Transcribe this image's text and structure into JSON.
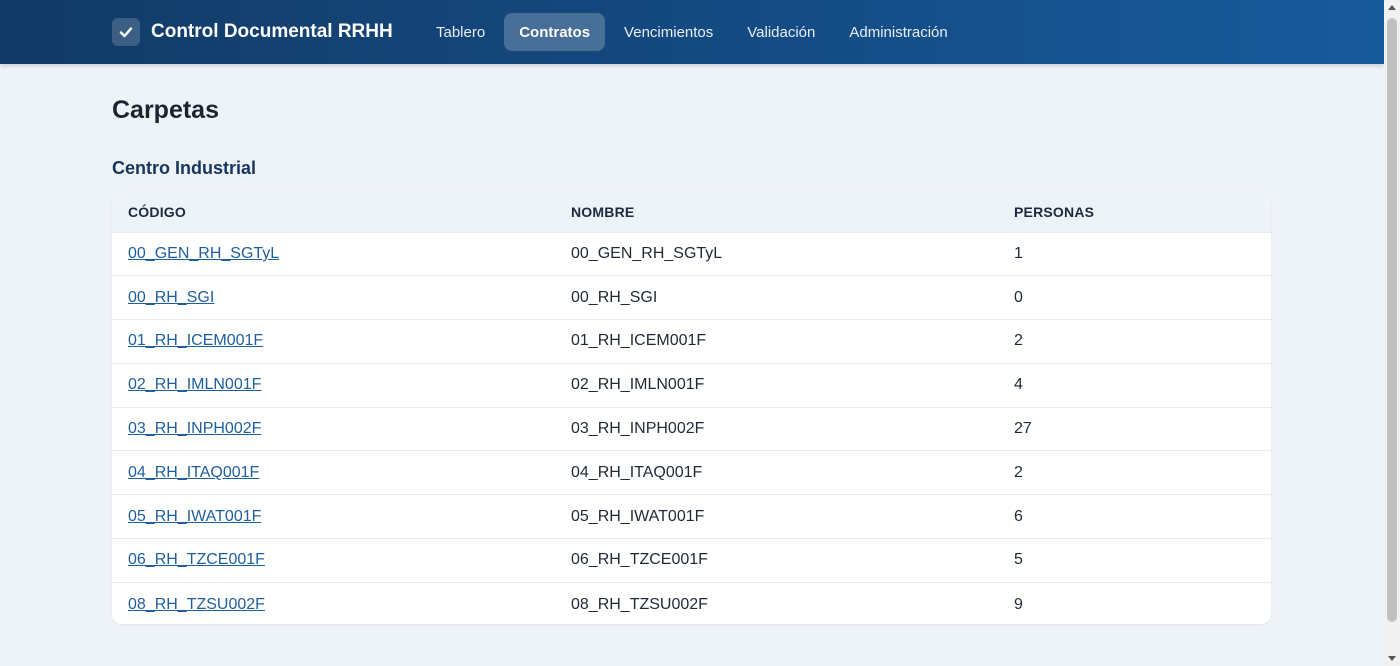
{
  "app": {
    "title": "Control Documental RRHH",
    "nav": [
      {
        "label": "Tablero",
        "active": false
      },
      {
        "label": "Contratos",
        "active": true
      },
      {
        "label": "Vencimientos",
        "active": false
      },
      {
        "label": "Validación",
        "active": false
      },
      {
        "label": "Administración",
        "active": false
      }
    ]
  },
  "page": {
    "title": "Carpetas",
    "section": "Centro Industrial"
  },
  "table": {
    "headers": [
      "CÓDIGO",
      "NOMBRE",
      "PERSONAS"
    ],
    "rows": [
      {
        "code": "00_GEN_RH_SGTyL",
        "name": "00_GEN_RH_SGTyL",
        "persons": "1"
      },
      {
        "code": "00_RH_SGI",
        "name": "00_RH_SGI",
        "persons": "0"
      },
      {
        "code": "01_RH_ICEM001F",
        "name": "01_RH_ICEM001F",
        "persons": "2"
      },
      {
        "code": "02_RH_IMLN001F",
        "name": "02_RH_IMLN001F",
        "persons": "4"
      },
      {
        "code": "03_RH_INPH002F",
        "name": "03_RH_INPH002F",
        "persons": "27"
      },
      {
        "code": "04_RH_ITAQ001F",
        "name": "04_RH_ITAQ001F",
        "persons": "2"
      },
      {
        "code": "05_RH_IWAT001F",
        "name": "05_RH_IWAT001F",
        "persons": "6"
      },
      {
        "code": "06_RH_TZCE001F",
        "name": "06_RH_TZCE001F",
        "persons": "5"
      },
      {
        "code": "08_RH_TZSU002F",
        "name": "08_RH_TZSU002F",
        "persons": "9"
      }
    ]
  },
  "icons": {
    "brand": "check-icon"
  },
  "colors": {
    "header_start": "#123a66",
    "header_end": "#175a9c",
    "link": "#1f5f9e",
    "background": "#eef3f8"
  }
}
